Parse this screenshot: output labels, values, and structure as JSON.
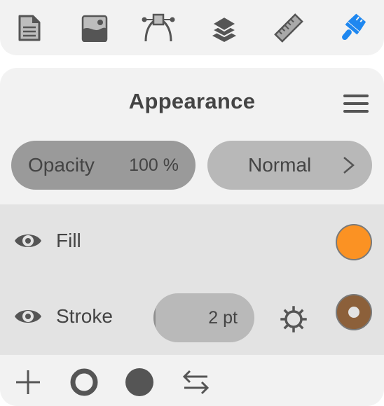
{
  "toolbar": {
    "items": [
      {
        "icon": "document-icon",
        "label": "Document",
        "active": false
      },
      {
        "icon": "image-icon",
        "label": "Image",
        "active": false
      },
      {
        "icon": "bezier-path-icon",
        "label": "Path",
        "active": false
      },
      {
        "icon": "layers-icon",
        "label": "Layers",
        "active": false
      },
      {
        "icon": "ruler-icon",
        "label": "Measure",
        "active": false
      },
      {
        "icon": "paintbrush-icon",
        "label": "Appearance",
        "active": true
      }
    ],
    "active_color": "#1e87f0",
    "icon_color": "#555555"
  },
  "panel": {
    "title": "Appearance",
    "menu_icon": "hamburger-menu-icon",
    "opacity": {
      "label": "Opacity",
      "value": "100 %"
    },
    "blend_mode": {
      "value": "Normal",
      "icon": "chevron-right-icon"
    },
    "fill": {
      "label": "Fill",
      "visible": true,
      "color": "#fb9223",
      "visibility_icon": "eye-icon"
    },
    "stroke": {
      "label": "Stroke",
      "visible": true,
      "width": "2 pt",
      "width_slider_fraction": 0.02,
      "color": "#8c603a",
      "settings_icon": "gear-icon",
      "visibility_icon": "eye-icon"
    },
    "bottom_bar": [
      {
        "icon": "add-icon",
        "label": "Add"
      },
      {
        "icon": "stroke-only-icon",
        "label": "Stroke"
      },
      {
        "icon": "fill-only-icon",
        "label": "Fill"
      },
      {
        "icon": "swap-arrows-icon",
        "label": "Swap"
      }
    ]
  }
}
